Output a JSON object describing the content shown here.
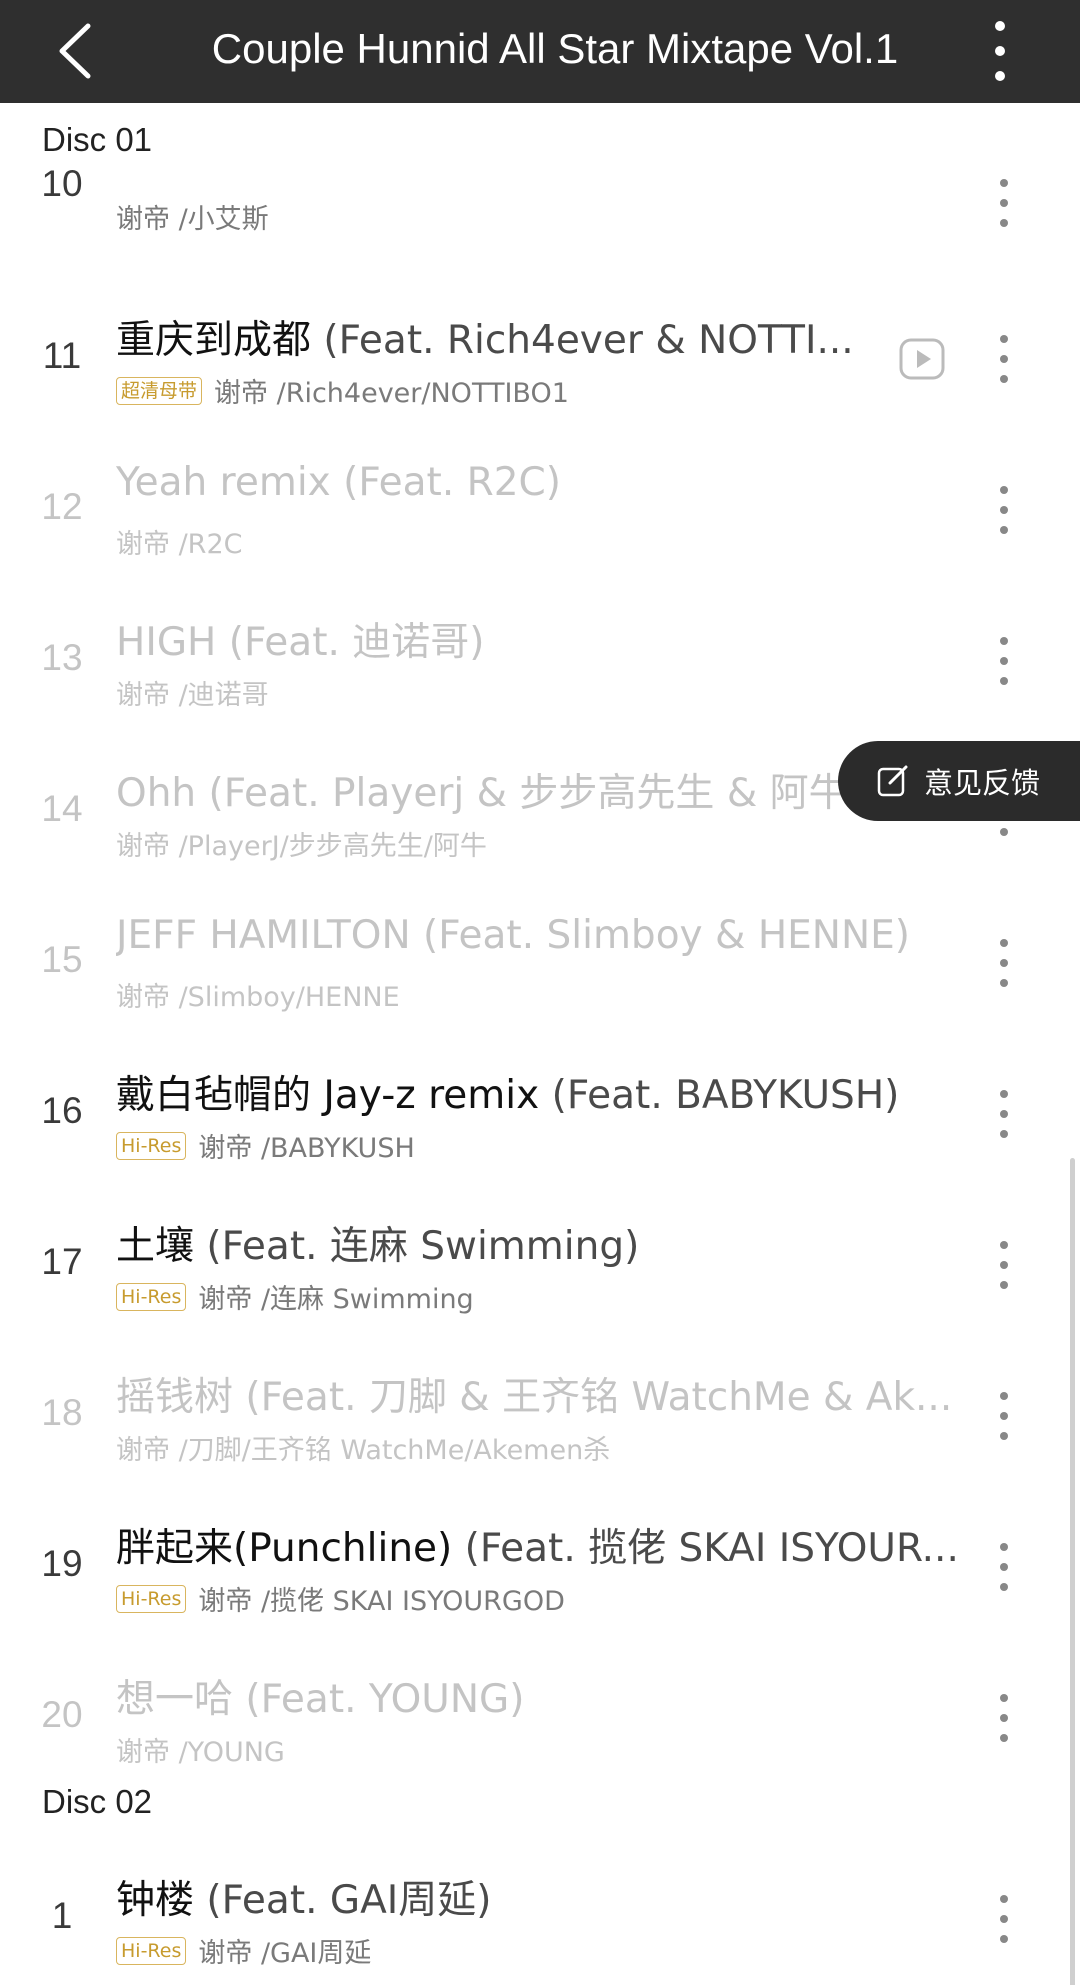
{
  "header": {
    "title": "Couple Hunnid All Star Mixtape Vol.1",
    "back_icon": "chevron-left-icon",
    "more_icon": "vertical-more-icon"
  },
  "discs": [
    {
      "label": "Disc 01"
    },
    {
      "label": "Disc 02"
    }
  ],
  "tracks": [
    {
      "num": "10",
      "title": "",
      "feat": "",
      "artists": "谢帝 /小艾斯",
      "badge": "",
      "dim": false
    },
    {
      "num": "11",
      "title": "重庆到成都",
      "feat": " (Feat. Rich4ever & NOTTI...",
      "artists": "谢帝 /Rich4ever/NOTTIBO1",
      "badge": "超清母带",
      "dim": false,
      "video": true
    },
    {
      "num": "12",
      "title": "Yeah remix",
      "feat": " (Feat. R2C)",
      "artists": "谢帝 /R2C",
      "badge": "",
      "dim": true
    },
    {
      "num": "13",
      "title": "HIGH",
      "feat": " (Feat. 迪诺哥)",
      "artists": "谢帝 /迪诺哥",
      "badge": "",
      "dim": true
    },
    {
      "num": "14",
      "title": "Ohh",
      "feat": " (Feat. Playerj & 步步高先生 & 阿牛)",
      "artists": "谢帝 /PlayerJ/步步高先生/阿牛",
      "badge": "",
      "dim": true
    },
    {
      "num": "15",
      "title": "JEFF HAMILTON",
      "feat": " (Feat. Slimboy & HENNE)",
      "artists": "谢帝 /Slimboy/HENNE",
      "badge": "",
      "dim": true
    },
    {
      "num": "16",
      "title": "戴白毡帽的 Jay-z remix",
      "feat": " (Feat. BABYKUSH)",
      "artists": "谢帝 /BABYKUSH",
      "badge": "Hi-Res",
      "dim": false
    },
    {
      "num": "17",
      "title": "土壤",
      "feat": " (Feat. 连麻 Swimming)",
      "artists": "谢帝 /连麻 Swimming",
      "badge": "Hi-Res",
      "dim": false
    },
    {
      "num": "18",
      "title": "摇钱树",
      "feat": " (Feat. 刀脚 & 王齐铭 WatchMe & Ak...",
      "artists": "谢帝 /刀脚/王齐铭 WatchMe/Akemen杀",
      "badge": "",
      "dim": true
    },
    {
      "num": "19",
      "title": "胖起来(Punchline)",
      "feat": " (Feat. 揽佬 SKAI ISYOUR...",
      "artists": "谢帝 /揽佬 SKAI ISYOURGOD",
      "badge": "Hi-Res",
      "dim": false
    },
    {
      "num": "20",
      "title": "想一哈",
      "feat": " (Feat. YOUNG)",
      "artists": "谢帝 /YOUNG",
      "badge": "",
      "dim": true
    },
    {
      "num": "1",
      "title": "钟楼",
      "feat": " (Feat. GAI周延)",
      "artists": "谢帝 /GAI周延",
      "badge": "Hi-Res",
      "dim": false
    }
  ],
  "feedback": {
    "label": "意见反馈",
    "icon": "edit-icon"
  },
  "colors": {
    "header_bg": "#2f2f2f",
    "badge_gold": "#c79b2e",
    "dim_text": "#c4c4c4"
  }
}
